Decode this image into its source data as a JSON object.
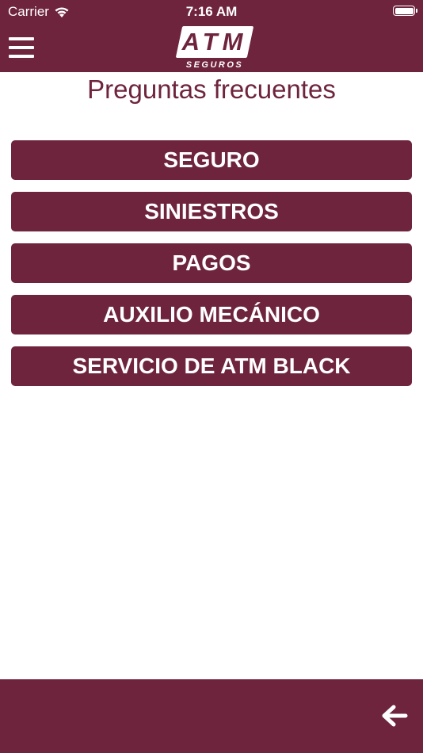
{
  "status_bar": {
    "carrier": "Carrier",
    "time": "7:16 AM"
  },
  "header": {
    "logo_text": "ATM",
    "logo_subtext": "SEGUROS"
  },
  "page": {
    "title": "Preguntas frecuentes"
  },
  "faq_buttons": [
    "SEGURO",
    "SINIESTROS",
    "PAGOS",
    "AUXILIO MECÁNICO",
    "SERVICIO DE ATM BLACK"
  ],
  "colors": {
    "brand": "#6e243c",
    "background": "#ffffff",
    "text_on_brand": "#ffffff"
  },
  "icons": {
    "menu": "hamburger-menu-icon",
    "back": "arrow-left-icon",
    "wifi": "wifi-icon",
    "battery": "battery-icon"
  }
}
